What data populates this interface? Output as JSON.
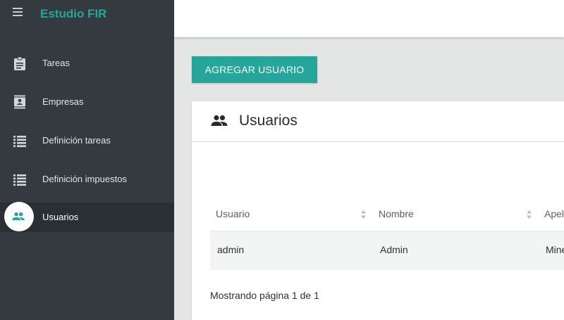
{
  "app": {
    "brand": "Estudio FIR"
  },
  "sidebar": {
    "items": [
      {
        "label": "Tareas",
        "icon": "clipboard-icon"
      },
      {
        "label": "Empresas",
        "icon": "contact-card-icon"
      },
      {
        "label": "Definición tareas",
        "icon": "list-icon"
      },
      {
        "label": "Definición impuestos",
        "icon": "list-icon"
      },
      {
        "label": "Usuarios",
        "icon": "people-icon",
        "active": true
      }
    ]
  },
  "toolbar": {
    "add_label": "AGREGAR USUARIO"
  },
  "card": {
    "title": "Usuarios",
    "columns": [
      "Usuario",
      "Nombre",
      "Apel"
    ],
    "rows": [
      [
        "admin",
        "Admin",
        "Mine"
      ]
    ],
    "pagination_text": "Mostrando página 1 de 1"
  },
  "colors": {
    "accent": "#26a69a",
    "sidebar_bg": "#343a40",
    "page_bg": "#e4e6e6"
  }
}
